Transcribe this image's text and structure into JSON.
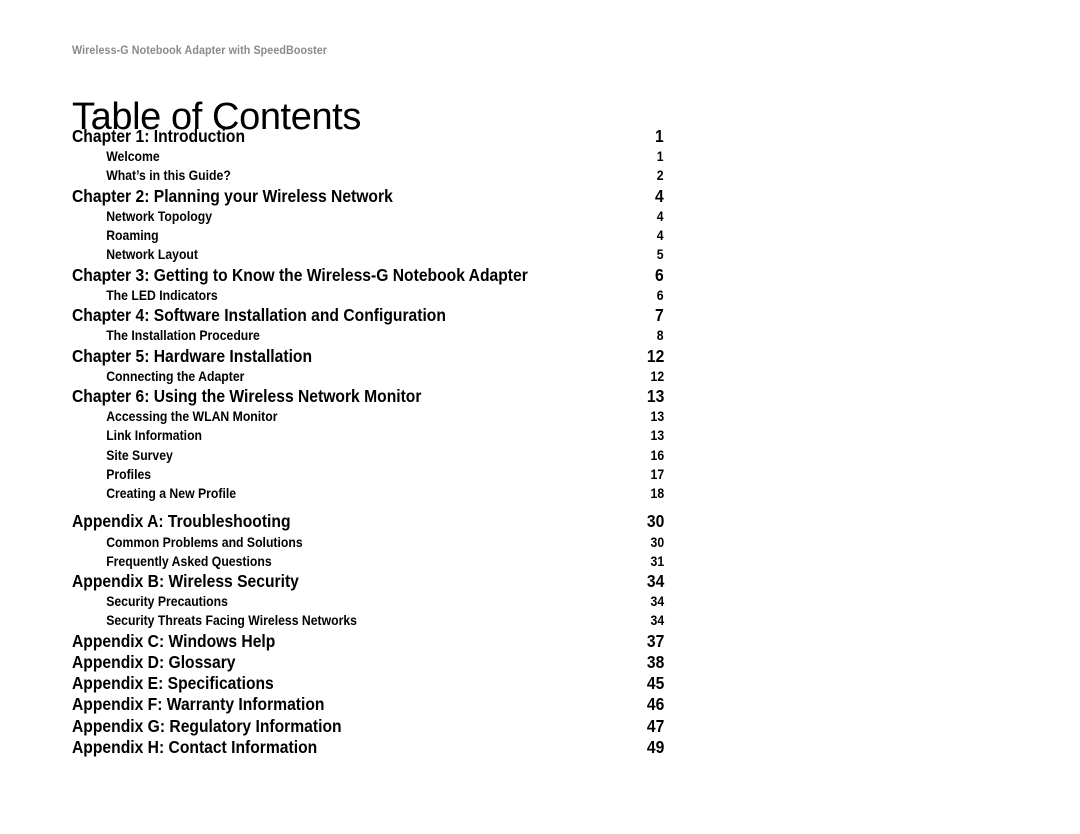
{
  "document": {
    "running_header": "Wireless-G Notebook Adapter with SpeedBooster",
    "title": "Table of Contents",
    "header_color": "#8a8a8a",
    "text_color": "#000000",
    "background_color": "#ffffff"
  },
  "toc": {
    "entries": [
      {
        "level": 1,
        "label": "Chapter 1: Introduction",
        "page": "1",
        "gap_before": false
      },
      {
        "level": 2,
        "label": "Welcome",
        "page": "1",
        "gap_before": false
      },
      {
        "level": 2,
        "label": "What’s in this Guide?",
        "page": "2",
        "gap_before": false
      },
      {
        "level": 1,
        "label": "Chapter 2: Planning your Wireless Network",
        "page": "4",
        "gap_before": false
      },
      {
        "level": 2,
        "label": "Network Topology",
        "page": "4",
        "gap_before": false
      },
      {
        "level": 2,
        "label": "Roaming",
        "page": "4",
        "gap_before": false
      },
      {
        "level": 2,
        "label": "Network Layout",
        "page": "5",
        "gap_before": false
      },
      {
        "level": 1,
        "label": "Chapter 3: Getting to Know the Wireless-G Notebook Adapter",
        "page": "6",
        "gap_before": false
      },
      {
        "level": 2,
        "label": "The LED Indicators",
        "page": "6",
        "gap_before": false
      },
      {
        "level": 1,
        "label": "Chapter 4: Software Installation and Configuration",
        "page": "7",
        "gap_before": false
      },
      {
        "level": 2,
        "label": "The Installation Procedure",
        "page": "8",
        "gap_before": false
      },
      {
        "level": 1,
        "label": "Chapter 5: Hardware Installation",
        "page": "12",
        "gap_before": false
      },
      {
        "level": 2,
        "label": "Connecting the Adapter",
        "page": "12",
        "gap_before": false
      },
      {
        "level": 1,
        "label": "Chapter 6: Using the Wireless Network Monitor",
        "page": "13",
        "gap_before": false
      },
      {
        "level": 2,
        "label": "Accessing the WLAN Monitor",
        "page": "13",
        "gap_before": false
      },
      {
        "level": 2,
        "label": "Link Information",
        "page": "13",
        "gap_before": false
      },
      {
        "level": 2,
        "label": "Site Survey",
        "page": "16",
        "gap_before": false
      },
      {
        "level": 2,
        "label": "Profiles",
        "page": "17",
        "gap_before": false
      },
      {
        "level": 2,
        "label": "Creating a New Profile",
        "page": "18",
        "gap_before": false
      },
      {
        "level": 1,
        "label": "Appendix A: Troubleshooting",
        "page": "30",
        "gap_before": true
      },
      {
        "level": 2,
        "label": "Common Problems and Solutions",
        "page": "30",
        "gap_before": false
      },
      {
        "level": 2,
        "label": "Frequently Asked Questions",
        "page": "31",
        "gap_before": false
      },
      {
        "level": 1,
        "label": "Appendix B: Wireless Security",
        "page": "34",
        "gap_before": false
      },
      {
        "level": 2,
        "label": "Security Precautions",
        "page": "34",
        "gap_before": false
      },
      {
        "level": 2,
        "label": "Security Threats Facing Wireless Networks",
        "page": "34",
        "gap_before": false
      },
      {
        "level": 1,
        "label": "Appendix C: Windows Help",
        "page": "37",
        "gap_before": false
      },
      {
        "level": 1,
        "label": "Appendix D: Glossary",
        "page": "38",
        "gap_before": false
      },
      {
        "level": 1,
        "label": "Appendix E: Specifications",
        "page": "45",
        "gap_before": false
      },
      {
        "level": 1,
        "label": "Appendix F: Warranty Information",
        "page": "46",
        "gap_before": false
      },
      {
        "level": 1,
        "label": "Appendix G: Regulatory Information",
        "page": "47",
        "gap_before": false
      },
      {
        "level": 1,
        "label": "Appendix H: Contact Information",
        "page": "49",
        "gap_before": false
      }
    ]
  }
}
